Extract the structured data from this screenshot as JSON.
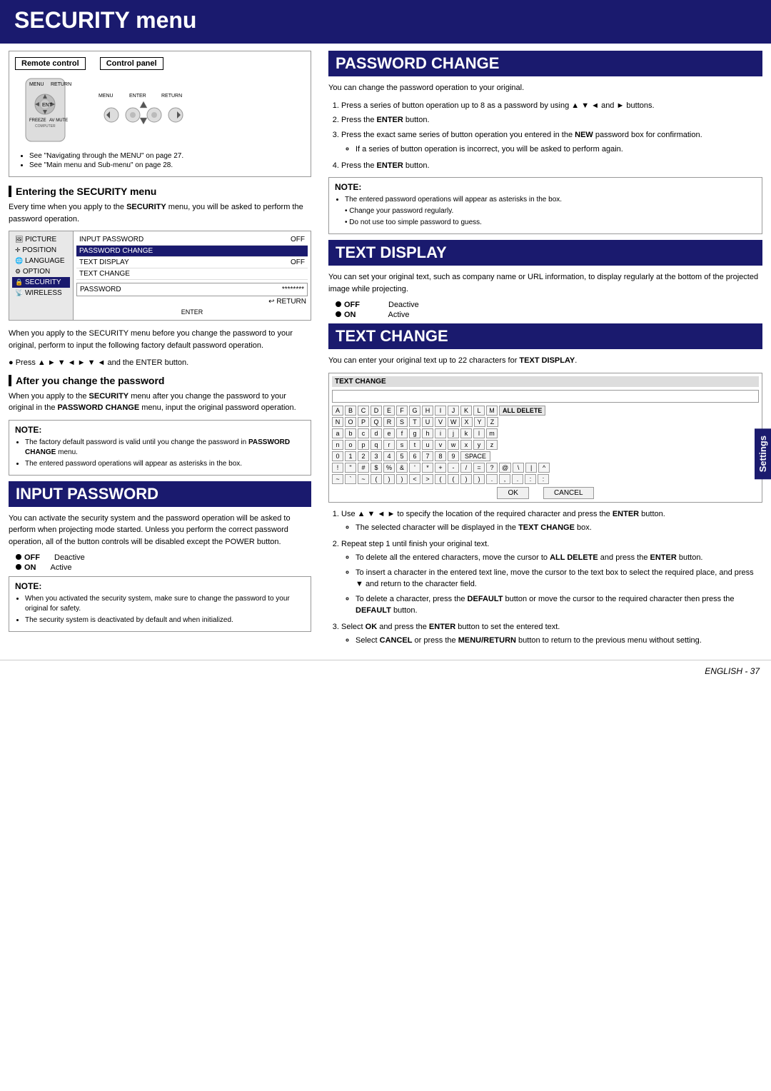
{
  "page": {
    "title": "SECURITY menu",
    "footer": "ENGLISH - 37"
  },
  "remote_box": {
    "label1": "Remote control",
    "label2": "Control panel",
    "bullets": [
      "See \"Navigating through the MENU\" on page 27.",
      "See \"Main menu and Sub-menu\" on page 28."
    ]
  },
  "entering_section": {
    "title": "Entering the SECURITY menu",
    "body": "Every time when you apply to the SECURITY menu, you will be asked to perform the password operation.",
    "menu_items_left": [
      "PICTURE",
      "POSITION",
      "LANGUAGE",
      "OPTION",
      "SECURITY",
      "WIRELESS"
    ],
    "menu_items_right": [
      {
        "label": "INPUT PASSWORD",
        "value": "OFF"
      },
      {
        "label": "PASSWORD CHANGE",
        "value": ""
      },
      {
        "label": "TEXT DISPLAY",
        "value": "OFF"
      },
      {
        "label": "TEXT CHANGE",
        "value": ""
      }
    ],
    "password_label": "PASSWORD",
    "password_value": "********"
  },
  "body_after_diagram": "When you apply to the SECURITY menu before you change the password to your original, perform to input the following factory default password operation.",
  "press_instruction": "Press ▲ ► ▼ ◄ ► ▼ ◄ and the ENTER button.",
  "after_password": {
    "title": "After you change the password",
    "body": "When you apply to the SECURITY menu after you change the password to your original in the PASSWORD CHANGE menu, input the original password operation."
  },
  "note1": {
    "title": "NOTE:",
    "items": [
      "The factory default password is valid until you change the password in PASSWORD CHANGE menu.",
      "The entered password operations will appear as asterisks in the box."
    ]
  },
  "input_password": {
    "section_header": "INPUT PASSWORD",
    "body": "You can activate the security system and the password operation will be asked to perform when projecting mode started. Unless you perform the correct password operation, all of the button controls will be disabled except the POWER button.",
    "off_label": "OFF",
    "off_value": "Deactive",
    "on_label": "ON",
    "on_value": "Active"
  },
  "note2": {
    "title": "NOTE:",
    "items": [
      "When you activated the security system, make sure to change the password to your original for safety.",
      "The security system is deactivated by default and when initialized."
    ]
  },
  "password_change": {
    "section_header": "PASSWORD CHANGE",
    "body": "You can change the password operation to your original.",
    "steps": [
      "Press a series of button operation up to 8 as a password by using ▲ ▼ ◄ and ► buttons.",
      "Press the ENTER button.",
      "Press the exact same series of button operation you entered in the NEW password box for confirmation.",
      "Press the ENTER button."
    ],
    "sub_bullet": "If a series of button operation is incorrect, you will be asked to perform again."
  },
  "note3": {
    "title": "NOTE:",
    "items": [
      "The entered password operations will appear as asterisks in the box.",
      "Change your password regularly.",
      "Do not use too simple password to guess."
    ]
  },
  "text_display": {
    "section_header": "TEXT DISPLAY",
    "body": "You can set your original text, such as company name or URL information, to display regularly at the bottom of the projected image while projecting.",
    "off_label": "OFF",
    "off_value": "Deactive",
    "on_label": "ON",
    "on_value": "Active"
  },
  "text_change": {
    "section_header": "TEXT CHANGE",
    "body": "You can enter your original text up to 22 characters for TEXT DISPLAY.",
    "keyboard_title": "TEXT CHANGE",
    "rows": [
      [
        "A",
        "B",
        "C",
        "D",
        "E",
        "F",
        "G",
        "H",
        "I",
        "J",
        "K",
        "L",
        "M"
      ],
      [
        "N",
        "O",
        "P",
        "Q",
        "R",
        "S",
        "T",
        "U",
        "V",
        "W",
        "X",
        "Y",
        "Z"
      ],
      [
        "a",
        "b",
        "c",
        "d",
        "e",
        "f",
        "g",
        "h",
        "i",
        "j",
        "k",
        "l",
        "m"
      ],
      [
        "n",
        "o",
        "p",
        "q",
        "r",
        "s",
        "t",
        "u",
        "v",
        "w",
        "x",
        "y",
        "z"
      ],
      [
        "0",
        "1",
        "2",
        "3",
        "4",
        "5",
        "6",
        "7",
        "8",
        "9",
        "SPACE"
      ],
      [
        "!",
        "\"",
        "#",
        "$",
        "%",
        "&",
        "'",
        "*",
        "+",
        "-",
        "/",
        "=",
        "?",
        "@",
        "\\",
        "|",
        "^"
      ],
      [
        "~",
        "'",
        "~",
        "(",
        ")",
        ")",
        "<",
        ">",
        "(",
        "(",
        ")",
        ")",
        ".",
        ",",
        ".",
        ":",
        ":"
      ]
    ],
    "all_delete": "ALL DELETE",
    "ok_btn": "OK",
    "cancel_btn": "CANCEL",
    "steps": [
      "Use ▲ ▼ ◄ ► to specify the location of the required character and press the ENTER button.",
      "Repeat step 1 until finish your original text.",
      "Select OK and press the ENTER button to set the entered text."
    ],
    "sub_bullets_step1": "The selected character will be displayed in the TEXT CHANGE box.",
    "sub_bullets_step2a": "To delete all the entered characters, move the cursor to ALL DELETE and press the ENTER button.",
    "sub_bullets_step2b": "To insert a character in the entered text line, move the cursor to the text box to select the required place, and press ▼ and return to the character field.",
    "sub_bullets_step2c": "To delete a character, press the DEFAULT button or move the cursor to the required character then press the DEFAULT button.",
    "sub_bullets_step3": "Select CANCEL or press the MENU/RETURN button to return to the previous menu without setting."
  },
  "settings_tab": "Settings"
}
